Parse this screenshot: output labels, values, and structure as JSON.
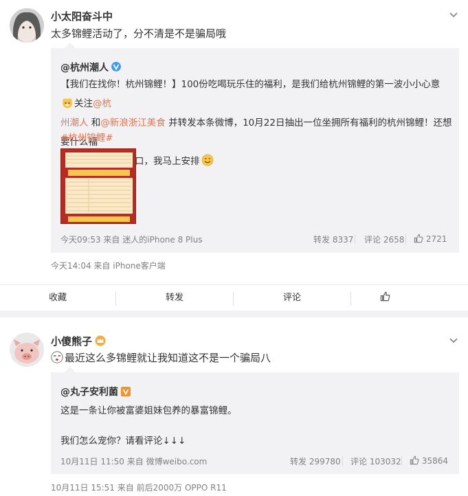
{
  "post1": {
    "author": "小太阳奋斗中",
    "text": "太多锦鲤活动了，分不清是不是骗局哦",
    "repost": {
      "author": "@杭州潮人",
      "line1_pre": "【我们在找你！杭州锦鲤！】100份吃喝玩乐住的福利，是我们给杭州锦鲤的第一波小小心意",
      "line1_post": "关注",
      "mention1_a": "@杭",
      "mention1_b": "州潮人",
      "line2_and": " 和",
      "mention2": "@新浪浙江美食",
      "line2_post": " 并转发本条微博，10月22日抽出一位坐拥所有福利的杭州锦鲤！还想要什么福",
      "line3": "利，评论区尽管开口，我马上安排",
      "hashtag": "#杭州锦鲤#",
      "time": "今天09:53",
      "from_label": "来自",
      "source": "迷人的iPhone 8 Plus",
      "repost_label": "转发 8337",
      "comment_label": "评论 2658",
      "like_count": "2721"
    },
    "meta_time": "今天14:04",
    "meta_from": "来自",
    "meta_source": "iPhone客户端",
    "actions": {
      "collect": "收藏",
      "repost": "转发",
      "comment": "评论"
    }
  },
  "post2": {
    "author": "小傻熊子",
    "text": "最近这么多锦鲤就让我知道这不是一个骗局八",
    "repost": {
      "author": "@丸子安利菌",
      "line1": "这是一条让你被富婆姐妹包养的暴富锦鲤。",
      "line2": "我们怎么宠你？请看评论↓↓↓",
      "time": "10月11日 11:50",
      "from_label": "来自",
      "source": "微博weibo.com",
      "repost_label": "转发 299780",
      "comment_label": "评论 103032",
      "like_count": "35864"
    },
    "meta_time": "10月11日 15:51",
    "meta_from": "来自",
    "meta_source": "前后2000万 OPPO R11"
  },
  "icons": {
    "chevron": "chevron-down-icon",
    "like": "thumbs-up-icon",
    "verified": "verified-v-icon",
    "vip": "vip-crown-icon"
  },
  "colors": {
    "link": "#eb7350",
    "repost_bg": "#f2f2f5",
    "verified": "#3c9df0",
    "muted": "#808080"
  }
}
